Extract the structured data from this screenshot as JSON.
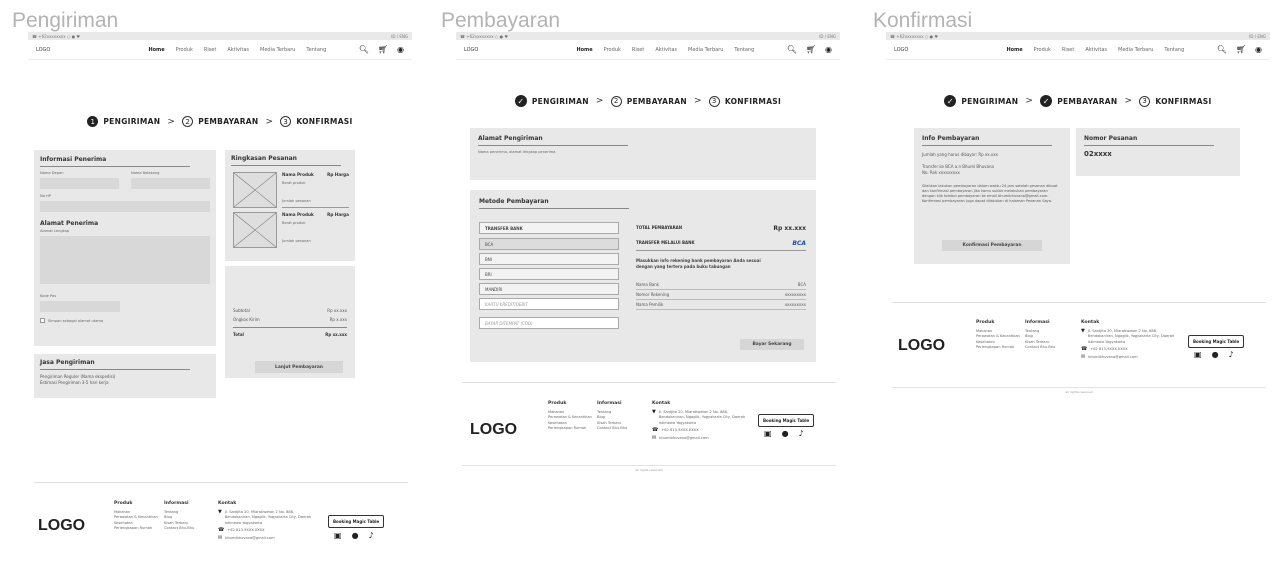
{
  "frames": [
    {
      "title": "Pengiriman"
    },
    {
      "title": "Pembayaran"
    },
    {
      "title": "Konfirmasi"
    }
  ],
  "topbar": {
    "left": "☎ +62xxxxxxxx  ○ ● ♥",
    "right": "ID / ENG"
  },
  "nav": {
    "logo": "LOGO",
    "links": [
      "Home",
      "Produk",
      "Riset",
      "Aktivitas",
      "Media Terbaru",
      "Tentang"
    ]
  },
  "steps": {
    "step1": "PENGIRIMAN",
    "step2": "PEMBAYARAN",
    "step3": "KONFIRMASI",
    "n1": "1",
    "n2": "2",
    "n3": "3"
  },
  "pengiriman": {
    "info_title": "Informasi Penerima",
    "nama_depan": "Nama Depan",
    "nama_belakang": "Nama Belakang",
    "no_hp": "No HP",
    "alamat_title": "Alamat Penerima",
    "alamat_lengkap": "Alamat Lengkap",
    "kode_pos": "Kode Pos",
    "simpan": "Simpan sebagai alamat utama",
    "jasa_title": "Jasa Pengiriman",
    "jasa_reguler": "Pengiriman Reguler (Nama ekspedisi)",
    "jasa_estimasi": "Estimasi Pengiriman 3-5 hari kerja",
    "ringkasan_title": "Ringkasan Pesanan",
    "items": [
      {
        "name": "Nama Produk",
        "price": "Rp Harga",
        "desc": "Berat produk",
        "qty": "Jumlah pesanan"
      },
      {
        "name": "Nama Produk",
        "price": "Rp Harga",
        "desc": "Berat produk",
        "qty": "Jumlah pesanan"
      }
    ],
    "subtotal_label": "Subtotal",
    "subtotal": "Rp xx.xxx",
    "ongkir_label": "Ongkos Kirim",
    "ongkir": "Rp x.xxx",
    "total_label": "Total",
    "total": "Rp xx.xxx",
    "lanjut": "Lanjut Pembayaran"
  },
  "pembayaran": {
    "alamat_title": "Alamat Pengiriman",
    "alamat_text": "Nama penerima, alamat lengkap penerima",
    "metode_title": "Metode Pembayaran",
    "methods": [
      "TRANSFER BANK",
      "BCA",
      "BNI",
      "BRI",
      "MANDIRI",
      "KARTU KREDIT/DEBIT",
      "BAYAR DITEMPAT (COD)"
    ],
    "total_label": "TOTAL PEMBAYARAN",
    "total": "Rp xx.xxx",
    "via_label": "TRANSFER MELALUI BANK",
    "bank_logo": "BCA",
    "instruksi": "Masukkan info rekening bank pembayaran Anda sesuai dengan yang tertera pada buku tabungan",
    "nama_bank_label": "Nama Bank",
    "nama_bank": "BCA",
    "no_rek_label": "Nomor Rekening",
    "no_rek": "xxxxxxxxx",
    "pemilik_label": "Nama Pemilik",
    "pemilik": "xxxxxxxxx",
    "bayar": "Bayar Sekarang"
  },
  "konfirmasi": {
    "info_title": "Info Pembayaran",
    "jumlah": "Jumlah yang harus dibayar: Rp xx.xxx",
    "transfer": "Transfer ke BCA a.n Bhumi Bhuvana",
    "norek": "No. Rek xxxxxxxxx",
    "kirim": "Silahkan lakukan pembayaran dalam waktu 24 jam setelah pesanan dibuat dan konfirmasi pembayaran jika kamu sudah melakukan pembayaran dengan klik tombol pembayaran ke email bhumibhuvana@gmail.com. Konfirmasi pembayaran juga dapat dilakukan di halaman Pesanan Saya.",
    "btn": "Konfirmasi Pembayaran",
    "nomor_title": "Nomor Pesanan",
    "nomor": "02xxxx"
  },
  "footer": {
    "logo": "LOGO",
    "produk_title": "Produk",
    "produk": [
      "Makanan",
      "Perawatan & Kecantikan",
      "Kesehatan",
      "Perlengkapan Rumah"
    ],
    "info_title": "Informasi",
    "info": [
      "Tentang",
      "Blog",
      "Kisah Terbaru",
      "Contact Bhu.Bhu"
    ],
    "kontak_title": "Kontak",
    "alamat": "Jl. Sardjito 20, Mlaratiwetan 2 No. 888, Bendokaniran, Ngaglik, Yogyakarta City, Daerah Istimewa Yogyakarta",
    "telp": "+62 813-9XXX-XXXX",
    "email": "bhumibhuvana@gmail.com",
    "booking": "Booking Magic Table",
    "copyright": "all rights reserved"
  }
}
